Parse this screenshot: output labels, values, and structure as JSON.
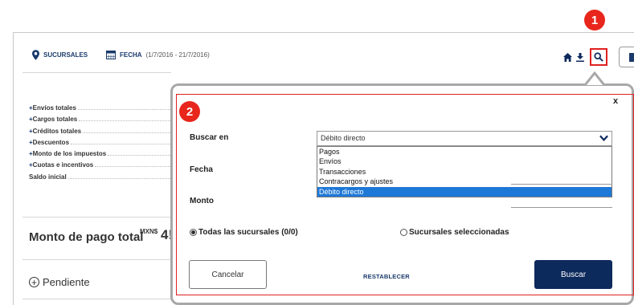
{
  "header": {
    "branches_label": "SUCURSALES",
    "date_label": "FECHA",
    "date_range": "(1/7/2016 - 21/7/2016)"
  },
  "summary": {
    "rows": [
      {
        "prefix": "+",
        "label": "Envíos totales"
      },
      {
        "prefix": "+",
        "label": "Cargos totales"
      },
      {
        "prefix": "+",
        "label": "Créditos totales"
      },
      {
        "prefix": "+",
        "label": "Descuentos"
      },
      {
        "prefix": "+",
        "label": "Monto de los impuestos"
      },
      {
        "prefix": "+",
        "label": "Cuotas e incentivos"
      },
      {
        "prefix": "",
        "label": "Saldo inicial"
      }
    ],
    "total_label": "Monto de pago total",
    "currency": "MXN$",
    "amount_partial": "4!",
    "pending_label": "Pendiente"
  },
  "badges": {
    "first": "1",
    "second": "2"
  },
  "search_panel": {
    "close": "x",
    "search_in_label": "Buscar en",
    "selected_value": "Débito directo",
    "options": [
      "Pagos",
      "Envíos",
      "Transacciones",
      "Contracargos y ajustes",
      "Débito directo"
    ],
    "selected_index": 4,
    "date_label": "Fecha",
    "amount_label": "Monto",
    "radio_all": "Todas las sucursales (0/0)",
    "radio_selected": "Sucursales seleccionadas",
    "cancel_label": "Cancelar",
    "reset_label": "RESTABLECER",
    "search_label": "Buscar"
  },
  "colors": {
    "brand_navy": "#0d2a5c",
    "highlight_red": "#e02020",
    "selection_blue": "#1e78d7"
  },
  "icons": [
    "location-pin-icon",
    "calendar-icon",
    "home-icon",
    "download-icon",
    "search-icon",
    "chevron-down-icon",
    "plus-circle-icon"
  ]
}
